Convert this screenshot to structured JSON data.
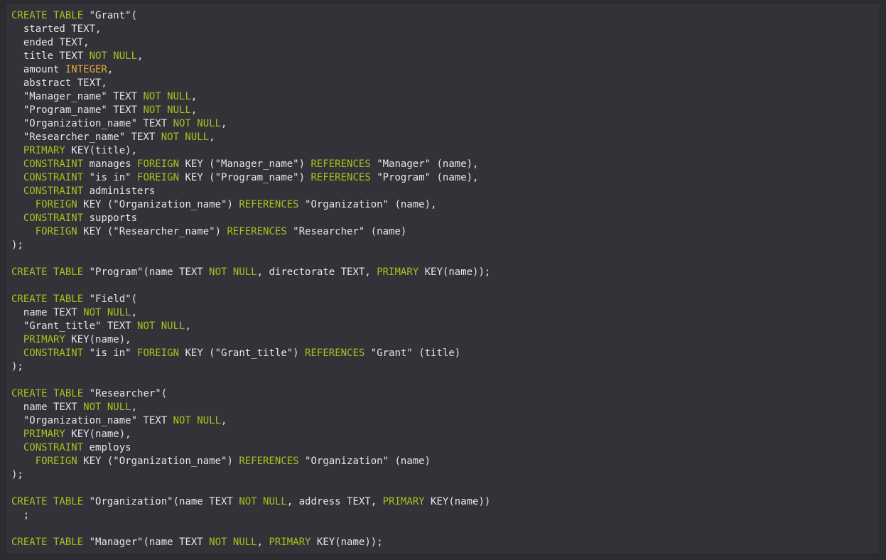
{
  "colors": {
    "background": "#323338",
    "text": "#e6e6e6",
    "keyword": "#a6c21f",
    "type_integer": "#e8a33e"
  },
  "code_lines": [
    [
      [
        "kw",
        "CREATE TABLE"
      ],
      [
        "pl",
        " \"Grant\"("
      ]
    ],
    [
      [
        "pl",
        "  started TEXT,"
      ]
    ],
    [
      [
        "pl",
        "  ended TEXT,"
      ]
    ],
    [
      [
        "pl",
        "  title TEXT "
      ],
      [
        "kw",
        "NOT NULL"
      ],
      [
        "pl",
        ","
      ]
    ],
    [
      [
        "pl",
        "  amount "
      ],
      [
        "num",
        "INTEGER"
      ],
      [
        "pl",
        ","
      ]
    ],
    [
      [
        "pl",
        "  abstract TEXT,"
      ]
    ],
    [
      [
        "pl",
        "  \"Manager_name\" TEXT "
      ],
      [
        "kw",
        "NOT NULL"
      ],
      [
        "pl",
        ","
      ]
    ],
    [
      [
        "pl",
        "  \"Program_name\" TEXT "
      ],
      [
        "kw",
        "NOT NULL"
      ],
      [
        "pl",
        ","
      ]
    ],
    [
      [
        "pl",
        "  \"Organization_name\" TEXT "
      ],
      [
        "kw",
        "NOT NULL"
      ],
      [
        "pl",
        ","
      ]
    ],
    [
      [
        "pl",
        "  \"Researcher_name\" TEXT "
      ],
      [
        "kw",
        "NOT NULL"
      ],
      [
        "pl",
        ","
      ]
    ],
    [
      [
        "pl",
        "  "
      ],
      [
        "kw",
        "PRIMARY"
      ],
      [
        "pl",
        " KEY(title),"
      ]
    ],
    [
      [
        "pl",
        "  "
      ],
      [
        "kw",
        "CONSTRAINT"
      ],
      [
        "pl",
        " manages "
      ],
      [
        "kw",
        "FOREIGN"
      ],
      [
        "pl",
        " KEY (\"Manager_name\") "
      ],
      [
        "kw",
        "REFERENCES"
      ],
      [
        "pl",
        " \"Manager\" (name),"
      ]
    ],
    [
      [
        "pl",
        "  "
      ],
      [
        "kw",
        "CONSTRAINT"
      ],
      [
        "pl",
        " \"is in\" "
      ],
      [
        "kw",
        "FOREIGN"
      ],
      [
        "pl",
        " KEY (\"Program_name\") "
      ],
      [
        "kw",
        "REFERENCES"
      ],
      [
        "pl",
        " \"Program\" (name),"
      ]
    ],
    [
      [
        "pl",
        "  "
      ],
      [
        "kw",
        "CONSTRAINT"
      ],
      [
        "pl",
        " administers"
      ]
    ],
    [
      [
        "pl",
        "    "
      ],
      [
        "kw",
        "FOREIGN"
      ],
      [
        "pl",
        " KEY (\"Organization_name\") "
      ],
      [
        "kw",
        "REFERENCES"
      ],
      [
        "pl",
        " \"Organization\" (name),"
      ]
    ],
    [
      [
        "pl",
        "  "
      ],
      [
        "kw",
        "CONSTRAINT"
      ],
      [
        "pl",
        " supports"
      ]
    ],
    [
      [
        "pl",
        "    "
      ],
      [
        "kw",
        "FOREIGN"
      ],
      [
        "pl",
        " KEY (\"Researcher_name\") "
      ],
      [
        "kw",
        "REFERENCES"
      ],
      [
        "pl",
        " \"Researcher\" (name)"
      ]
    ],
    [
      [
        "pl",
        ");"
      ]
    ],
    [],
    [
      [
        "kw",
        "CREATE TABLE"
      ],
      [
        "pl",
        " \"Program\"(name TEXT "
      ],
      [
        "kw",
        "NOT NULL"
      ],
      [
        "pl",
        ", directorate TEXT, "
      ],
      [
        "kw",
        "PRIMARY"
      ],
      [
        "pl",
        " KEY(name));"
      ]
    ],
    [],
    [
      [
        "kw",
        "CREATE TABLE"
      ],
      [
        "pl",
        " \"Field\"("
      ]
    ],
    [
      [
        "pl",
        "  name TEXT "
      ],
      [
        "kw",
        "NOT NULL"
      ],
      [
        "pl",
        ","
      ]
    ],
    [
      [
        "pl",
        "  \"Grant_title\" TEXT "
      ],
      [
        "kw",
        "NOT NULL"
      ],
      [
        "pl",
        ","
      ]
    ],
    [
      [
        "pl",
        "  "
      ],
      [
        "kw",
        "PRIMARY"
      ],
      [
        "pl",
        " KEY(name),"
      ]
    ],
    [
      [
        "pl",
        "  "
      ],
      [
        "kw",
        "CONSTRAINT"
      ],
      [
        "pl",
        " \"is in\" "
      ],
      [
        "kw",
        "FOREIGN"
      ],
      [
        "pl",
        " KEY (\"Grant_title\") "
      ],
      [
        "kw",
        "REFERENCES"
      ],
      [
        "pl",
        " \"Grant\" (title)"
      ]
    ],
    [
      [
        "pl",
        ");"
      ]
    ],
    [],
    [
      [
        "kw",
        "CREATE TABLE"
      ],
      [
        "pl",
        " \"Researcher\"("
      ]
    ],
    [
      [
        "pl",
        "  name TEXT "
      ],
      [
        "kw",
        "NOT NULL"
      ],
      [
        "pl",
        ","
      ]
    ],
    [
      [
        "pl",
        "  \"Organization_name\" TEXT "
      ],
      [
        "kw",
        "NOT NULL"
      ],
      [
        "pl",
        ","
      ]
    ],
    [
      [
        "pl",
        "  "
      ],
      [
        "kw",
        "PRIMARY"
      ],
      [
        "pl",
        " KEY(name),"
      ]
    ],
    [
      [
        "pl",
        "  "
      ],
      [
        "kw",
        "CONSTRAINT"
      ],
      [
        "pl",
        " employs"
      ]
    ],
    [
      [
        "pl",
        "    "
      ],
      [
        "kw",
        "FOREIGN"
      ],
      [
        "pl",
        " KEY (\"Organization_name\") "
      ],
      [
        "kw",
        "REFERENCES"
      ],
      [
        "pl",
        " \"Organization\" (name)"
      ]
    ],
    [
      [
        "pl",
        ");"
      ]
    ],
    [],
    [
      [
        "kw",
        "CREATE TABLE"
      ],
      [
        "pl",
        " \"Organization\"(name TEXT "
      ],
      [
        "kw",
        "NOT NULL"
      ],
      [
        "pl",
        ", address TEXT, "
      ],
      [
        "kw",
        "PRIMARY"
      ],
      [
        "pl",
        " KEY(name))"
      ]
    ],
    [
      [
        "pl",
        "  ;"
      ]
    ],
    [],
    [
      [
        "kw",
        "CREATE TABLE"
      ],
      [
        "pl",
        " \"Manager\"(name TEXT "
      ],
      [
        "kw",
        "NOT NULL"
      ],
      [
        "pl",
        ", "
      ],
      [
        "kw",
        "PRIMARY"
      ],
      [
        "pl",
        " KEY(name));"
      ]
    ]
  ]
}
